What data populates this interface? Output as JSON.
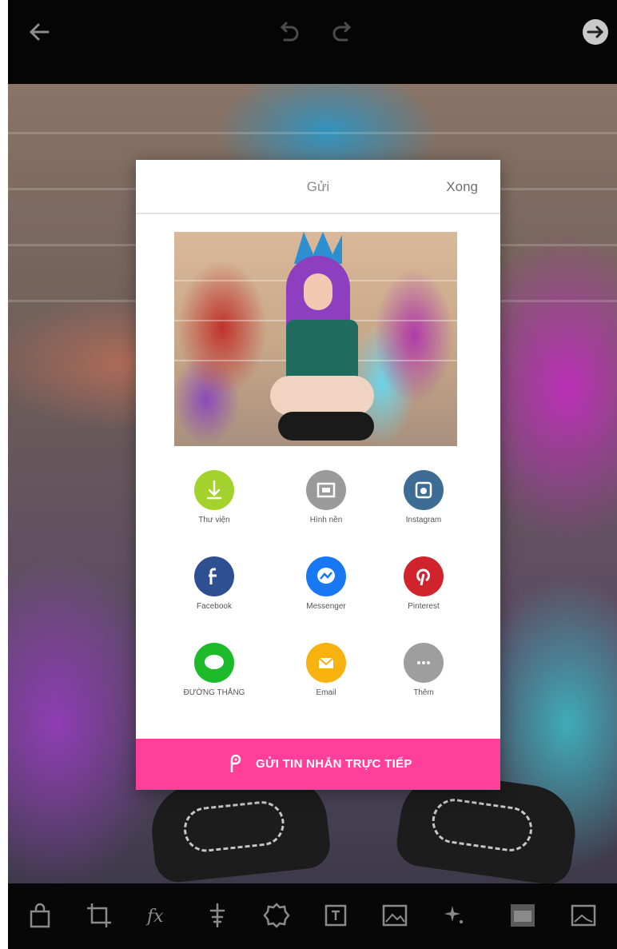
{
  "header": {
    "back_icon": "arrow-left-icon",
    "undo_icon": "undo-icon",
    "redo_icon": "redo-icon",
    "next_icon": "arrow-right-circle-icon"
  },
  "dialog": {
    "title": "Gửi",
    "done_label": "Xong",
    "share_items": [
      {
        "label": "Thư viện",
        "icon": "download-icon",
        "color": "#a4d22c"
      },
      {
        "label": "Hình nền",
        "icon": "wallpaper-icon",
        "color": "#9a9a9a"
      },
      {
        "label": "Instagram",
        "icon": "instagram-icon",
        "color": "#3d6c94"
      },
      {
        "label": "Facebook",
        "icon": "facebook-icon",
        "color": "#2f4f93"
      },
      {
        "label": "Messenger",
        "icon": "messenger-icon",
        "color": "#1877f2"
      },
      {
        "label": "Pinterest",
        "icon": "pinterest-icon",
        "color": "#d0232c"
      },
      {
        "label": "ĐƯỜNG THẲNG",
        "icon": "line-icon",
        "color": "#1dbb2a"
      },
      {
        "label": "Email",
        "icon": "email-icon",
        "color": "#f7b20f"
      },
      {
        "label": "Thêm",
        "icon": "more-icon",
        "color": "#9e9e9e"
      }
    ],
    "cta_label": "GỬI TIN NHẮN TRỰC TIẾP",
    "cta_icon": "picsart-icon",
    "cta_color": "#ff3f9a"
  },
  "toolbar": {
    "tools": [
      "shopping-bag-icon",
      "crop-icon",
      "effects-fx-icon",
      "retouch-icon",
      "sticker-icon",
      "text-icon",
      "add-photo-icon",
      "sparkle-icon",
      "frame-icon",
      "background-icon"
    ]
  }
}
